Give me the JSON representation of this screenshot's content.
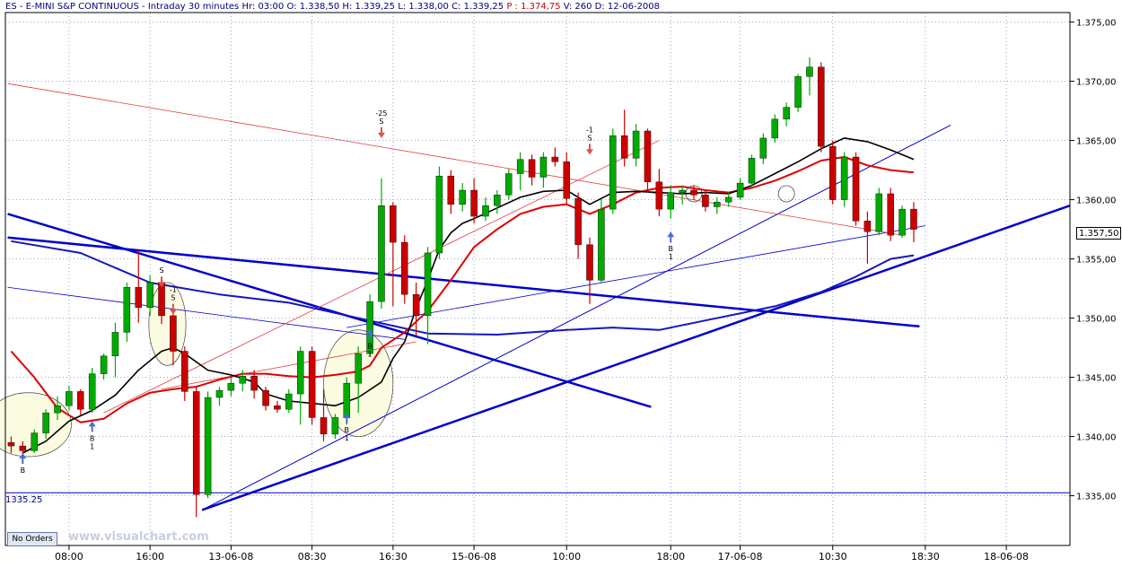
{
  "header": {
    "symbol": "ES",
    "name": "E-MINI S&P CONTINUOUS",
    "interval": "Intraday 30 minutes",
    "hr": "Hr: 03:00",
    "open": "O: 1.338,50",
    "high": "H: 1.339,25",
    "low": "L: 1.338,00",
    "close": "C: 1.339,25",
    "p": "P : 1.374,75",
    "volume": "V: 260",
    "date": "D: 12-06-2008"
  },
  "no_orders_label": "No Orders",
  "watermark": "www.visualchart.com",
  "level_label": "1335.25",
  "last_price_label": "1.357,50",
  "colors": {
    "up_candle": "#00aa00",
    "down_candle": "#cc0000",
    "ma_fast": "#000000",
    "ma_mid": "#dd0000",
    "ma_slow": "#1515c0",
    "trendline": "#0000cc",
    "header_text": "#000080",
    "highlight_fill": "#fbfbe2",
    "buy_arrow": "#4a6cd4",
    "sell_arrow": "#e05050"
  },
  "signals": [
    {
      "label_top": "",
      "label_mid": "B",
      "label_bot": "",
      "type": "buy",
      "x": 1,
      "y": 1338.6
    },
    {
      "label_top": "",
      "label_mid": "B",
      "label_bot": "1",
      "type": "buy",
      "x": 7,
      "y": 1341.3
    },
    {
      "label_top": "",
      "label_mid": "S",
      "label_bot": "",
      "type": "sell",
      "x": 13,
      "y": 1352.6
    },
    {
      "label_top": "-1",
      "label_mid": "S",
      "label_bot": "",
      "type": "sell",
      "x": 14,
      "y": 1350.3
    },
    {
      "label_top": "",
      "label_mid": "B",
      "label_bot": "1",
      "type": "buy",
      "x": 29,
      "y": 1342.0
    },
    {
      "label_top": "",
      "label_mid": "B",
      "label_bot": "1",
      "type": "buy",
      "x": 31,
      "y": 1349.1
    },
    {
      "label_top": "-25",
      "label_mid": "S",
      "label_bot": "",
      "type": "sell",
      "x": 32,
      "y": 1365.2
    },
    {
      "label_top": "-1",
      "label_mid": "S",
      "label_bot": "",
      "type": "sell",
      "x": 50,
      "y": 1363.8
    },
    {
      "label_top": "",
      "label_mid": "B",
      "label_bot": "1",
      "type": "buy",
      "x": 57,
      "y": 1357.3
    }
  ],
  "chart_data": {
    "type": "candlestick",
    "title": "",
    "xlabel": "",
    "ylabel": "",
    "ylim": [
      1330.8,
      1375.8
    ],
    "yticks": [
      1335,
      1340,
      1345,
      1350,
      1355,
      1360,
      1365,
      1370,
      1375
    ],
    "ytick_labels": [
      "1.335,00",
      "1.340,00",
      "1.345,00",
      "1.350,00",
      "1.355,00",
      "1.360,00",
      "1.365,00",
      "1.370,00",
      "1.375,00"
    ],
    "xticks": [
      {
        "index": 5,
        "label": "08:00"
      },
      {
        "index": 12,
        "label": "16:00"
      },
      {
        "index": 19,
        "label": "13-06-08"
      },
      {
        "index": 26,
        "label": "08:30"
      },
      {
        "index": 33,
        "label": "16:30"
      },
      {
        "index": 40,
        "label": "15-06-08"
      },
      {
        "index": 48,
        "label": "10:00"
      },
      {
        "index": 57,
        "label": "18:00"
      },
      {
        "index": 63,
        "label": "17-06-08"
      },
      {
        "index": 71,
        "label": "10:30"
      },
      {
        "index": 79,
        "label": "18:30"
      },
      {
        "index": 86,
        "label": "18-06-08"
      }
    ],
    "n_bars": 79,
    "x_range": [
      -0.5,
      91.5
    ],
    "ohlc": [
      [
        1339.5,
        1340.0,
        1338.6,
        1339.2
      ],
      [
        1339.2,
        1339.6,
        1338.2,
        1338.8
      ],
      [
        1338.8,
        1340.6,
        1338.6,
        1340.3
      ],
      [
        1340.3,
        1342.3,
        1339.8,
        1342.0
      ],
      [
        1342.0,
        1343.4,
        1341.4,
        1342.6
      ],
      [
        1342.6,
        1344.3,
        1342.2,
        1343.8
      ],
      [
        1343.8,
        1344.0,
        1341.8,
        1342.3
      ],
      [
        1342.3,
        1345.8,
        1342.0,
        1345.3
      ],
      [
        1345.3,
        1347.0,
        1344.8,
        1346.8
      ],
      [
        1346.8,
        1349.6,
        1345.0,
        1348.8
      ],
      [
        1348.8,
        1353.0,
        1348.0,
        1352.6
      ],
      [
        1352.6,
        1355.7,
        1349.6,
        1350.9
      ],
      [
        1350.9,
        1353.6,
        1350.2,
        1353.0
      ],
      [
        1353.0,
        1353.4,
        1349.5,
        1350.2
      ],
      [
        1350.2,
        1350.8,
        1346.0,
        1347.2
      ],
      [
        1347.2,
        1347.6,
        1343.0,
        1343.8
      ],
      [
        1343.8,
        1344.3,
        1333.2,
        1335.1
      ],
      [
        1335.1,
        1343.8,
        1334.8,
        1343.3
      ],
      [
        1343.3,
        1344.2,
        1342.6,
        1343.9
      ],
      [
        1343.9,
        1345.0,
        1343.4,
        1344.5
      ],
      [
        1344.5,
        1345.6,
        1343.8,
        1345.1
      ],
      [
        1345.1,
        1345.6,
        1343.2,
        1343.9
      ],
      [
        1343.9,
        1344.2,
        1342.2,
        1342.6
      ],
      [
        1342.6,
        1343.0,
        1342.0,
        1342.3
      ],
      [
        1342.3,
        1344.0,
        1342.0,
        1343.6
      ],
      [
        1343.6,
        1347.6,
        1341.0,
        1347.2
      ],
      [
        1347.2,
        1347.6,
        1341.0,
        1341.6
      ],
      [
        1341.6,
        1344.0,
        1339.6,
        1340.2
      ],
      [
        1340.2,
        1341.9,
        1339.8,
        1341.6
      ],
      [
        1341.6,
        1345.0,
        1341.0,
        1344.5
      ],
      [
        1344.5,
        1347.6,
        1342.0,
        1347.0
      ],
      [
        1347.0,
        1352.0,
        1346.8,
        1351.4
      ],
      [
        1351.4,
        1361.8,
        1350.8,
        1359.5
      ],
      [
        1359.5,
        1359.8,
        1351.0,
        1356.4
      ],
      [
        1356.4,
        1357.0,
        1351.2,
        1352.0
      ],
      [
        1352.0,
        1353.0,
        1348.5,
        1350.2
      ],
      [
        1350.2,
        1356.0,
        1347.8,
        1355.5
      ],
      [
        1355.5,
        1362.8,
        1355.0,
        1362.0
      ],
      [
        1362.0,
        1362.5,
        1358.8,
        1359.6
      ],
      [
        1359.6,
        1361.4,
        1359.0,
        1360.8
      ],
      [
        1360.8,
        1361.8,
        1358.0,
        1358.6
      ],
      [
        1358.6,
        1360.2,
        1358.2,
        1359.5
      ],
      [
        1359.5,
        1360.8,
        1358.8,
        1360.4
      ],
      [
        1360.4,
        1362.6,
        1360.0,
        1362.2
      ],
      [
        1362.2,
        1364.0,
        1360.8,
        1363.4
      ],
      [
        1363.4,
        1363.8,
        1361.2,
        1361.9
      ],
      [
        1361.9,
        1364.0,
        1361.0,
        1363.6
      ],
      [
        1363.6,
        1364.4,
        1362.8,
        1363.2
      ],
      [
        1363.2,
        1364.0,
        1359.6,
        1360.1
      ],
      [
        1360.1,
        1360.6,
        1355.0,
        1356.2
      ],
      [
        1356.2,
        1356.8,
        1351.2,
        1353.2
      ],
      [
        1353.2,
        1360.0,
        1353.0,
        1359.2
      ],
      [
        1359.2,
        1366.0,
        1358.8,
        1365.4
      ],
      [
        1365.4,
        1367.6,
        1362.8,
        1363.5
      ],
      [
        1363.5,
        1366.4,
        1362.8,
        1365.8
      ],
      [
        1365.8,
        1366.0,
        1360.8,
        1361.5
      ],
      [
        1361.5,
        1362.6,
        1358.6,
        1359.2
      ],
      [
        1359.2,
        1361.2,
        1358.4,
        1360.6
      ],
      [
        1360.6,
        1361.2,
        1359.6,
        1360.8
      ],
      [
        1360.8,
        1361.2,
        1360.0,
        1360.4
      ],
      [
        1360.4,
        1360.8,
        1359.0,
        1359.4
      ],
      [
        1359.4,
        1360.2,
        1358.8,
        1359.8
      ],
      [
        1359.8,
        1360.6,
        1359.4,
        1360.2
      ],
      [
        1360.2,
        1361.8,
        1360.0,
        1361.4
      ],
      [
        1361.4,
        1363.8,
        1361.0,
        1363.5
      ],
      [
        1363.5,
        1365.6,
        1363.0,
        1365.2
      ],
      [
        1365.2,
        1367.2,
        1364.8,
        1366.8
      ],
      [
        1366.8,
        1368.2,
        1366.2,
        1367.8
      ],
      [
        1367.8,
        1370.6,
        1367.4,
        1370.4
      ],
      [
        1370.4,
        1372.0,
        1368.8,
        1371.2
      ],
      [
        1371.2,
        1371.6,
        1364.0,
        1364.5
      ],
      [
        1364.5,
        1365.0,
        1359.6,
        1360.0
      ],
      [
        1360.0,
        1364.0,
        1359.4,
        1363.6
      ],
      [
        1363.6,
        1364.0,
        1357.8,
        1358.2
      ],
      [
        1358.2,
        1359.0,
        1354.6,
        1357.3
      ],
      [
        1357.3,
        1361.0,
        1357.0,
        1360.5
      ],
      [
        1360.5,
        1361.0,
        1356.5,
        1357.0
      ],
      [
        1357.0,
        1359.5,
        1356.8,
        1359.2
      ],
      [
        1359.2,
        1359.8,
        1356.4,
        1357.5
      ]
    ],
    "ma_fast": [
      [
        1,
        1338.6
      ],
      [
        3,
        1339.6
      ],
      [
        5,
        1341.3
      ],
      [
        7,
        1342.2
      ],
      [
        9,
        1343.5
      ],
      [
        11,
        1345.6
      ],
      [
        13,
        1347.2
      ],
      [
        14,
        1347.5
      ],
      [
        15,
        1347.0
      ],
      [
        17,
        1345.6
      ],
      [
        19,
        1345.2
      ],
      [
        21,
        1344.6
      ],
      [
        22,
        1343.6
      ],
      [
        24,
        1343.0
      ],
      [
        26,
        1342.8
      ],
      [
        28,
        1342.6
      ],
      [
        30,
        1343.3
      ],
      [
        32,
        1344.6
      ],
      [
        33,
        1346.6
      ],
      [
        34,
        1348.0
      ],
      [
        35,
        1350.8
      ],
      [
        36,
        1353.2
      ],
      [
        37,
        1355.8
      ],
      [
        38,
        1357.2
      ],
      [
        39,
        1358.0
      ],
      [
        40,
        1358.4
      ],
      [
        42,
        1359.3
      ],
      [
        44,
        1360.2
      ],
      [
        46,
        1360.7
      ],
      [
        48,
        1360.8
      ],
      [
        50,
        1359.6
      ],
      [
        52,
        1360.6
      ],
      [
        54,
        1360.7
      ],
      [
        56,
        1360.6
      ],
      [
        58,
        1360.5
      ],
      [
        60,
        1360.6
      ],
      [
        62,
        1360.5
      ],
      [
        64,
        1361.2
      ],
      [
        66,
        1362.2
      ],
      [
        68,
        1363.2
      ],
      [
        70,
        1364.3
      ],
      [
        72,
        1365.2
      ],
      [
        74,
        1364.9
      ],
      [
        76,
        1364.2
      ],
      [
        78,
        1363.4
      ]
    ],
    "ma_mid": [
      [
        0,
        1347.2
      ],
      [
        2,
        1345.0
      ],
      [
        4,
        1342.4
      ],
      [
        6,
        1341.2
      ],
      [
        8,
        1341.5
      ],
      [
        10,
        1342.8
      ],
      [
        12,
        1343.7
      ],
      [
        14,
        1344.0
      ],
      [
        16,
        1344.2
      ],
      [
        18,
        1344.8
      ],
      [
        20,
        1345.3
      ],
      [
        22,
        1345.3
      ],
      [
        24,
        1345.1
      ],
      [
        26,
        1345.0
      ],
      [
        28,
        1345.2
      ],
      [
        30,
        1345.5
      ],
      [
        31,
        1346.0
      ],
      [
        32,
        1347.5
      ],
      [
        34,
        1348.8
      ],
      [
        36,
        1350.6
      ],
      [
        38,
        1353.2
      ],
      [
        40,
        1356.0
      ],
      [
        42,
        1357.5
      ],
      [
        44,
        1358.8
      ],
      [
        46,
        1359.4
      ],
      [
        48,
        1359.6
      ],
      [
        50,
        1358.8
      ],
      [
        52,
        1359.6
      ],
      [
        54,
        1360.6
      ],
      [
        56,
        1361.0
      ],
      [
        58,
        1361.1
      ],
      [
        60,
        1360.8
      ],
      [
        62,
        1360.6
      ],
      [
        64,
        1361.0
      ],
      [
        66,
        1361.6
      ],
      [
        68,
        1362.4
      ],
      [
        70,
        1363.3
      ],
      [
        72,
        1363.6
      ],
      [
        74,
        1362.9
      ],
      [
        76,
        1362.5
      ],
      [
        78,
        1362.3
      ]
    ],
    "ma_slow": [
      [
        0,
        1356.5
      ],
      [
        6,
        1355.5
      ],
      [
        12,
        1353.0
      ],
      [
        18,
        1352.0
      ],
      [
        24,
        1351.3
      ],
      [
        30,
        1350.0
      ],
      [
        36,
        1348.7
      ],
      [
        42,
        1348.6
      ],
      [
        48,
        1349.0
      ],
      [
        52,
        1349.2
      ],
      [
        56,
        1349.0
      ],
      [
        60,
        1349.8
      ],
      [
        66,
        1351.0
      ],
      [
        70,
        1352.2
      ],
      [
        73,
        1353.5
      ],
      [
        76,
        1355.0
      ],
      [
        78,
        1355.3
      ]
    ],
    "horizontal_level": 1335.25
  }
}
